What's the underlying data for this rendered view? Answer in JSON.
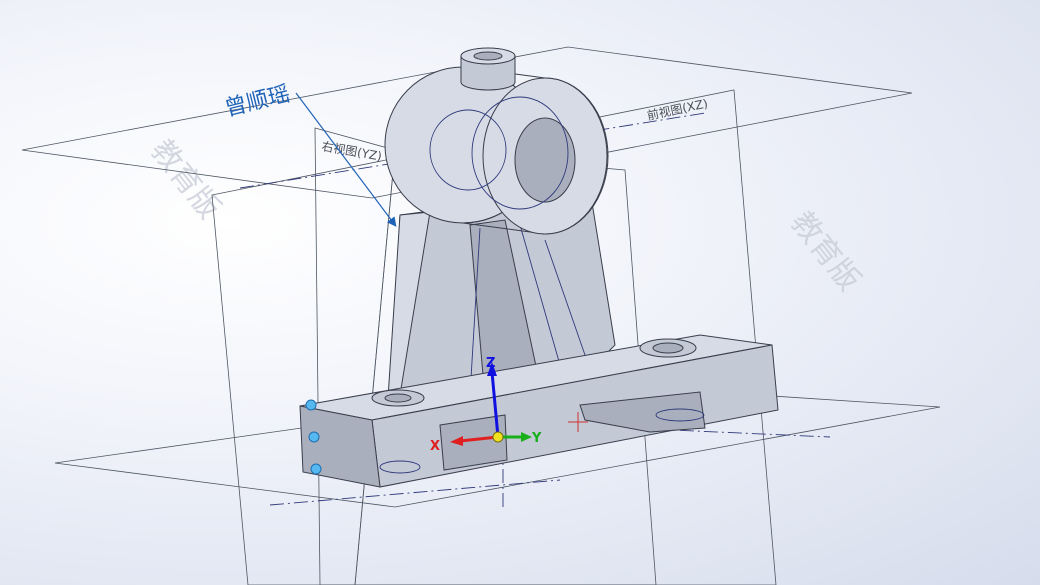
{
  "viewport": {
    "annotation_text": "曾顺瑶",
    "watermark_text": "教育版",
    "plane_labels": {
      "front": "前视图(XZ)",
      "right": "右视图(YZ)"
    },
    "triad": {
      "x_label": "X",
      "y_label": "Y",
      "z_label": "Z",
      "colors": {
        "x": "#e02020",
        "y": "#18b018",
        "z": "#1010e0",
        "origin": "#f0e020"
      }
    },
    "annotation_color": "#1f63b8",
    "part_color": "#c9cdd9"
  }
}
